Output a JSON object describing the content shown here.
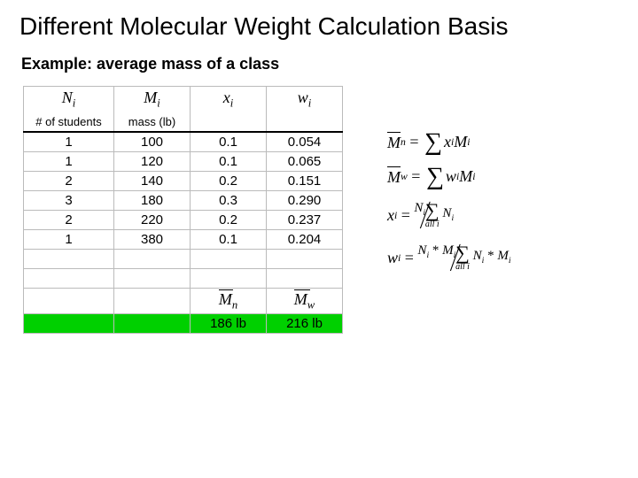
{
  "title": "Different Molecular Weight Calculation Basis",
  "subtitle": "Example: average mass of a class",
  "table": {
    "sym_headers": [
      "N",
      "M",
      "x",
      "w"
    ],
    "sym_sub": "i",
    "desc_headers": [
      "# of students",
      "mass (lb)",
      "",
      ""
    ],
    "rows": [
      [
        "1",
        "100",
        "0.1",
        "0.054"
      ],
      [
        "1",
        "120",
        "0.1",
        "0.065"
      ],
      [
        "2",
        "140",
        "0.2",
        "0.151"
      ],
      [
        "3",
        "180",
        "0.3",
        "0.290"
      ],
      [
        "2",
        "220",
        "0.2",
        "0.237"
      ],
      [
        "1",
        "380",
        "0.1",
        "0.204"
      ]
    ],
    "empty_rows": 2,
    "footer_syms": {
      "c": "M",
      "c_sub": "n",
      "d": "M",
      "d_sub": "w"
    },
    "results": {
      "c": "186 lb",
      "d": "216 lb"
    }
  },
  "formulas": {
    "mn_lhs_sym": "M",
    "mn_lhs_sub": "n",
    "mw_lhs_sym": "M",
    "mw_lhs_sub": "w",
    "eq": "=",
    "mn_rhs": "x",
    "mn_rhs2": "M",
    "mn_sub": "i",
    "mw_rhs": "w",
    "mw_rhs2": "M",
    "mw_sub": "i",
    "xi_lhs": "x",
    "xi_sub": "i",
    "xi_num": "N",
    "xi_num_sub": "i",
    "xi_den": "N",
    "xi_den_sub": "i",
    "xi_den_under": "all i",
    "wi_lhs": "w",
    "wi_sub": "i",
    "wi_num1": "N",
    "wi_num2": "M",
    "wi_num_sub": "i",
    "wi_den1": "N",
    "wi_den2": "M",
    "wi_den_sub": "i",
    "wi_den_under": "all i",
    "star": "*"
  },
  "chart_data": {
    "type": "table",
    "columns": [
      "N_i (# of students)",
      "M_i mass (lb)",
      "x_i",
      "w_i"
    ],
    "rows": [
      [
        1,
        100,
        0.1,
        0.054
      ],
      [
        1,
        120,
        0.1,
        0.065
      ],
      [
        2,
        140,
        0.2,
        0.151
      ],
      [
        3,
        180,
        0.3,
        0.29
      ],
      [
        2,
        220,
        0.2,
        0.237
      ],
      [
        1,
        380,
        0.1,
        0.204
      ]
    ],
    "summary": {
      "M_n": "186 lb",
      "M_w": "216 lb"
    }
  }
}
